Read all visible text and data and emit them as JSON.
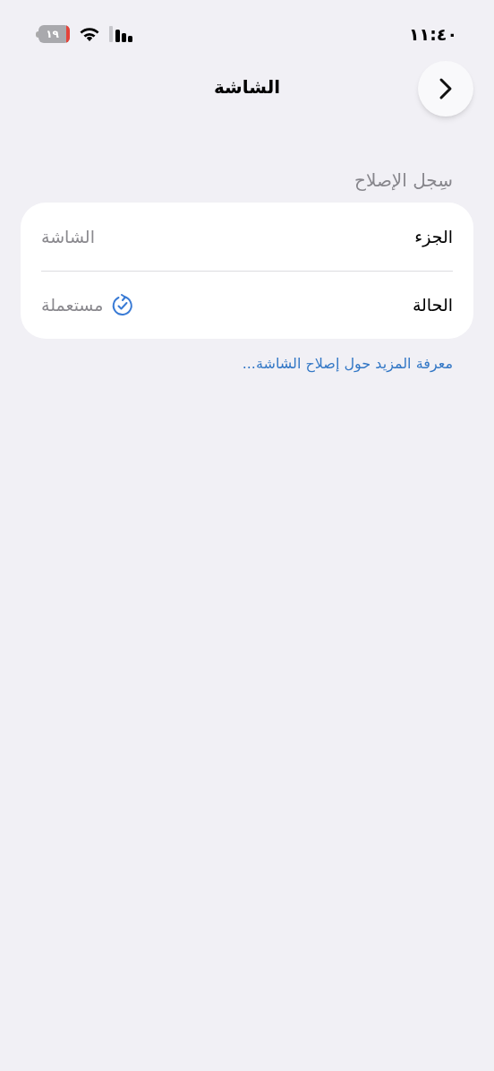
{
  "status_bar": {
    "time": "١١:٤٠",
    "battery": "١٩"
  },
  "nav": {
    "title": "الشاشة"
  },
  "section": {
    "header": "سِجل الإصلاح",
    "rows": [
      {
        "kind": "plain",
        "label": "الجزء",
        "value": "الشاشة"
      },
      {
        "kind": "status",
        "label": "الحالة",
        "value": "مستعملة"
      }
    ],
    "link": "معرفة المزيد حول إصلاح الشاشة..."
  }
}
